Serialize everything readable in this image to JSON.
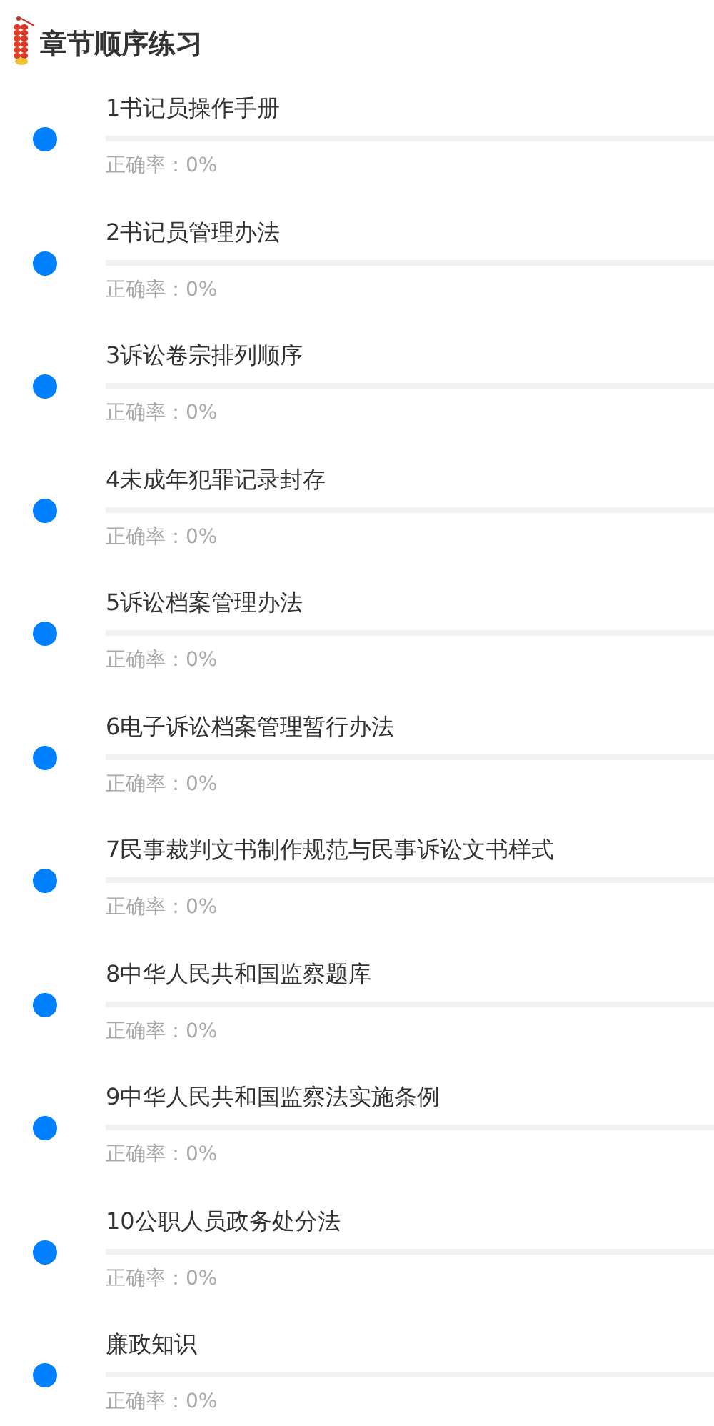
{
  "header": {
    "title": "章节顺序练习"
  },
  "chapters": [
    {
      "title": "1书记员操作手册",
      "level": 0,
      "accuracy": "正确率：0%"
    },
    {
      "title": "2书记员管理办法",
      "level": 0,
      "accuracy": "正确率：0%"
    },
    {
      "title": "3诉讼卷宗排列顺序",
      "level": 0,
      "accuracy": "正确率：0%"
    },
    {
      "title": "4未成年犯罪记录封存",
      "level": 0,
      "accuracy": "正确率：0%"
    },
    {
      "title": "5诉讼档案管理办法",
      "level": 0,
      "accuracy": "正确率：0%"
    },
    {
      "title": "6电子诉讼档案管理暂行办法",
      "level": 0,
      "accuracy": "正确率：0%"
    },
    {
      "title": "7民事裁判文书制作规范与民事诉讼文书样式",
      "level": 0,
      "accuracy": "正确率：0%"
    },
    {
      "title": "8中华人民共和国监察题库",
      "level": 0,
      "accuracy": "正确率：0%"
    },
    {
      "title": "9中华人民共和国监察法实施条例",
      "level": 0,
      "accuracy": "正确率：0%"
    },
    {
      "title": "10公职人员政务处分法",
      "level": 0,
      "accuracy": "正确率：0%"
    },
    {
      "title": "廉政知识",
      "level": 0,
      "accuracy": "正确率：0%"
    }
  ]
}
